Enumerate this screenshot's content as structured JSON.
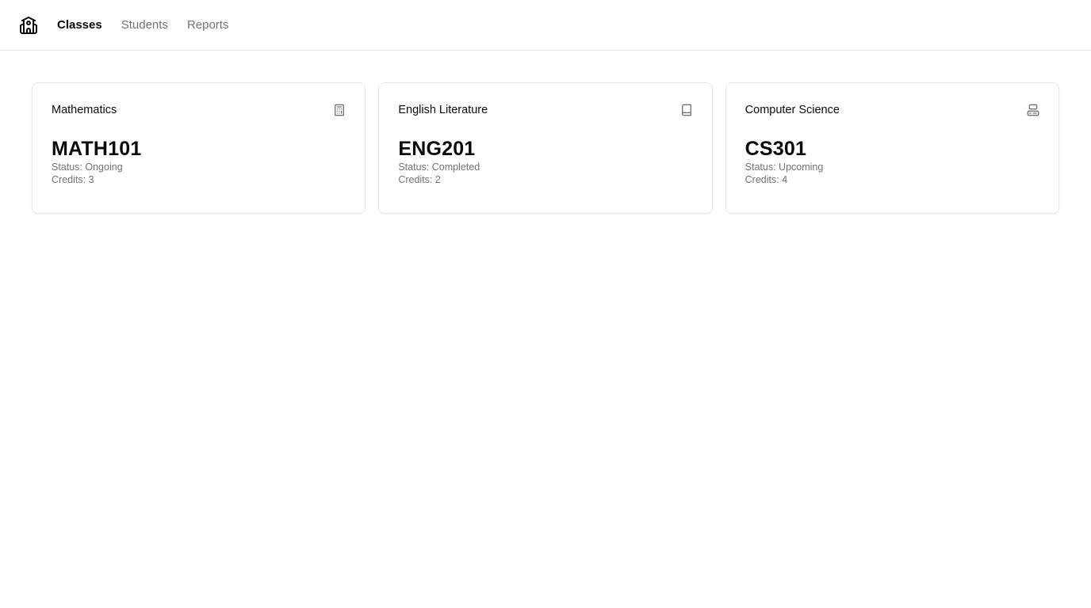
{
  "nav": {
    "logo_icon": "school-building-icon",
    "items": [
      {
        "label": "Classes",
        "active": true
      },
      {
        "label": "Students",
        "active": false
      },
      {
        "label": "Reports",
        "active": false
      }
    ]
  },
  "classes": [
    {
      "title": "Mathematics",
      "icon": "calculator-icon",
      "code": "MATH101",
      "status": "Status: Ongoing",
      "credits": "Credits: 3"
    },
    {
      "title": "English Literature",
      "icon": "book-icon",
      "code": "ENG201",
      "status": "Status: Completed",
      "credits": "Credits: 2"
    },
    {
      "title": "Computer Science",
      "icon": "computer-icon",
      "code": "CS301",
      "status": "Status: Upcoming",
      "credits": "Credits: 4"
    }
  ],
  "colors": {
    "text": "#0a0a0a",
    "muted": "#737373",
    "border": "#e5e7eb"
  }
}
